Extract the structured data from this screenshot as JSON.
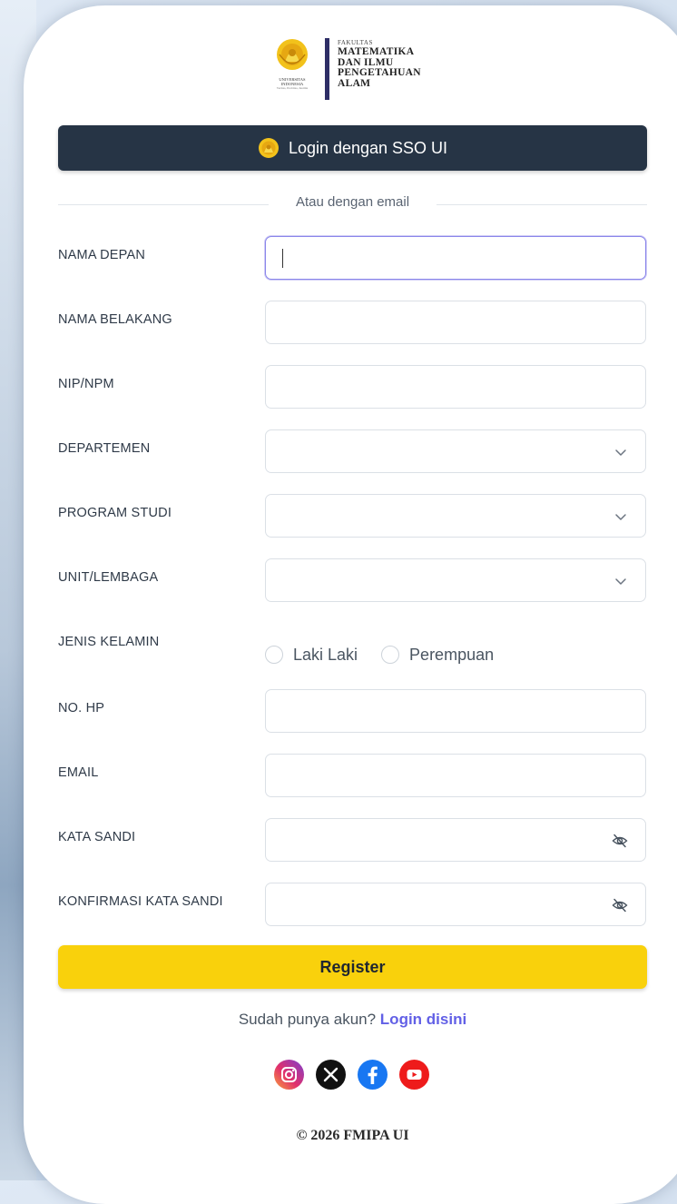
{
  "logo": {
    "emblem_caption_1": "UNIVERSITAS",
    "emblem_caption_2": "INDONESIA",
    "emblem_caption_3": "Veritas, Probitas, Iustitia",
    "faculty_small": "FAKULTAS",
    "faculty_name": "MATEMATIKA\nDAN ILMU\nPENGETAHUAN\nALAM"
  },
  "sso_button": {
    "label": "Login dengan SSO UI"
  },
  "divider": {
    "text": "Atau dengan email"
  },
  "form": {
    "first_name": {
      "label": "NAMA DEPAN",
      "value": ""
    },
    "last_name": {
      "label": "NAMA BELAKANG",
      "value": ""
    },
    "nip_npm": {
      "label": "NIP/NPM",
      "value": ""
    },
    "department": {
      "label": "DEPARTEMEN",
      "value": ""
    },
    "study_program": {
      "label": "PROGRAM STUDI",
      "value": ""
    },
    "unit": {
      "label": "UNIT/LEMBAGA",
      "value": ""
    },
    "gender": {
      "label": "JENIS KELAMIN",
      "options": [
        "Laki Laki",
        "Perempuan"
      ]
    },
    "phone": {
      "label": "NO. HP",
      "value": ""
    },
    "email": {
      "label": "EMAIL",
      "value": ""
    },
    "password": {
      "label": "KATA SANDI",
      "value": ""
    },
    "password_confirm": {
      "label": "KONFIRMASI KATA SANDI",
      "value": ""
    }
  },
  "register_button": {
    "label": "Register"
  },
  "login_prompt": {
    "text": "Sudah punya akun?",
    "link": "Login disini"
  },
  "socials": [
    "instagram-icon",
    "x-icon",
    "facebook-icon",
    "youtube-icon"
  ],
  "copyright": "© 2026 FMIPA UI",
  "colors": {
    "primary_dark": "#263445",
    "accent_yellow": "#f9d10c",
    "link": "#6260e6",
    "focus": "#8a86ea"
  }
}
